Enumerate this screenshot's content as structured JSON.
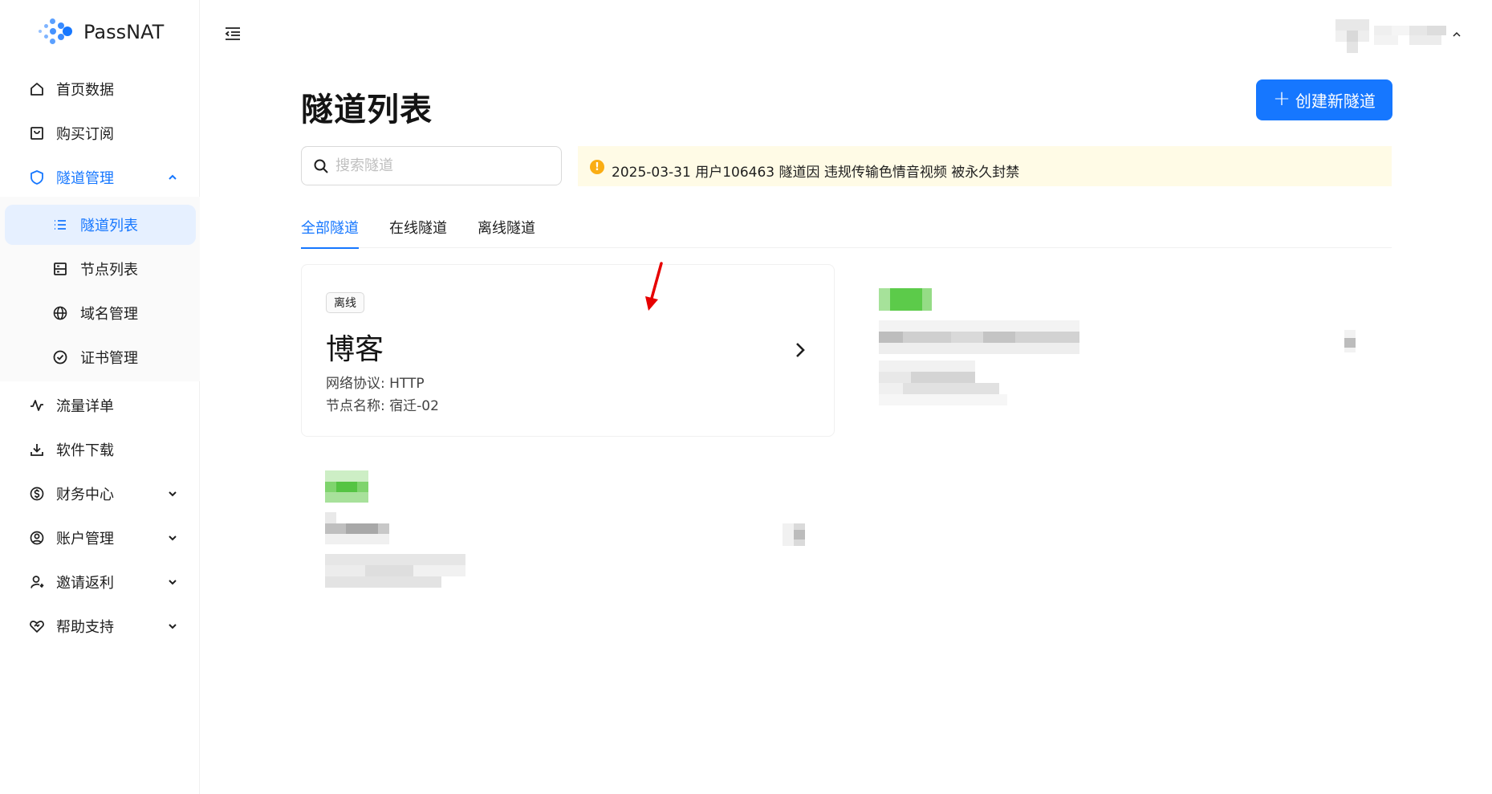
{
  "app": {
    "name": "PassNAT"
  },
  "sidebar": {
    "items": [
      {
        "label": "首页数据",
        "icon": "home-icon"
      },
      {
        "label": "购买订阅",
        "icon": "cart-icon"
      },
      {
        "label": "隧道管理",
        "icon": "shield-icon",
        "expanded": true
      },
      {
        "label": "流量详单",
        "icon": "activity-icon"
      },
      {
        "label": "软件下载",
        "icon": "download-icon"
      },
      {
        "label": "财务中心",
        "icon": "coin-icon"
      },
      {
        "label": "账户管理",
        "icon": "user-circle-icon"
      },
      {
        "label": "邀请返利",
        "icon": "user-invite-icon"
      },
      {
        "label": "帮助支持",
        "icon": "heart-help-icon"
      }
    ],
    "submenu": [
      {
        "label": "隧道列表",
        "icon": "list-icon",
        "active": true
      },
      {
        "label": "节点列表",
        "icon": "server-icon"
      },
      {
        "label": "域名管理",
        "icon": "globe-icon"
      },
      {
        "label": "证书管理",
        "icon": "check-circle-icon"
      }
    ]
  },
  "page": {
    "title": "隧道列表",
    "create_button": "创建新隧道",
    "search_placeholder": "搜索隧道",
    "notice": "2025-03-31 用户106463 隧道因 违规传输色情音视频 被永久封禁",
    "tabs": [
      {
        "label": "全部隧道",
        "active": true
      },
      {
        "label": "在线隧道"
      },
      {
        "label": "离线隧道"
      }
    ]
  },
  "tunnels": [
    {
      "status": "离线",
      "name": "博客",
      "protocol_label": "网络协议: HTTP",
      "node_label": "节点名称: 宿迁-02"
    }
  ],
  "colors": {
    "primary": "#1677ff",
    "notice_bg": "#fffbe6",
    "warning": "#faad14",
    "online_tag": "#52c41a",
    "annotation_arrow": "#e60000"
  }
}
